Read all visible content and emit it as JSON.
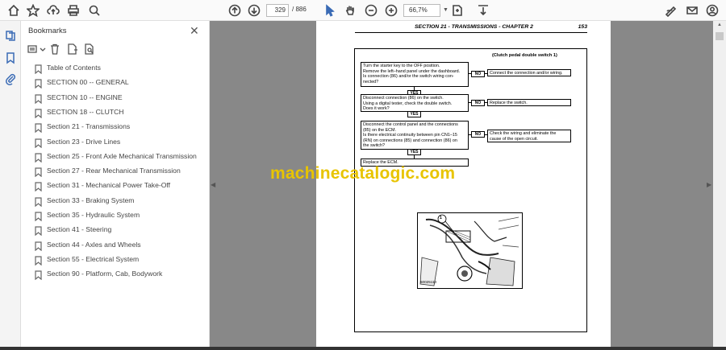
{
  "toolbar": {
    "icons": [
      "home-icon",
      "star-icon",
      "cloud-upload-icon",
      "print-icon",
      "zoom-search-icon",
      "page-up-icon",
      "page-down-icon",
      "pointer-icon",
      "hand-icon",
      "zoom-out-icon",
      "zoom-in-icon",
      "fit-page-icon",
      "scroll-mode-icon",
      "sign-icon",
      "mail-icon",
      "account-icon"
    ],
    "page_current": "329",
    "page_total": "/ 886",
    "zoom": "66,7%"
  },
  "bookmarks": {
    "title": "Bookmarks",
    "items": [
      {
        "label": "Table of Contents"
      },
      {
        "label": "SECTION 00 -- GENERAL"
      },
      {
        "label": "SECTION 10 -- ENGINE"
      },
      {
        "label": "SECTION 18 -- CLUTCH"
      },
      {
        "label": "Section 21 - Transmissions"
      },
      {
        "label": "Section 23 - Drive Lines"
      },
      {
        "label": "Section 25 - Front Axle Mechanical Transmission"
      },
      {
        "label": "Section 27 - Rear Mechanical Transmission"
      },
      {
        "label": "Section 31 - Mechanical Power Take-Off"
      },
      {
        "label": "Section 33 - Braking System"
      },
      {
        "label": "Section 35 - Hydraulic System"
      },
      {
        "label": "Section 41 - Steering"
      },
      {
        "label": "Section 44 - Axles and Wheels"
      },
      {
        "label": "Section 55 - Electrical System"
      },
      {
        "label": "Section 90 - Platform, Cab, Bodywork"
      }
    ]
  },
  "document": {
    "header": "SECTION 21 - TRANSMISSIONS - CHAPTER 2",
    "page_number": "153",
    "flowchart_title": "(Clutch pedal double switch 1)",
    "step1_line1": "Turn the starter key to the OFF position.",
    "step1_line2": "Remove the left–hand panel under the dashboard.",
    "step1_line3": "Is connection (86) and/or the switch wiring con-",
    "step1_line4": "nected?",
    "no1": "NO",
    "no1_result": "Connect the connection and/or wiring.",
    "yes1": "YES",
    "step2_line1": "Disconnect connection (86) on the switch.",
    "step2_line2": "Using a digital tester, check the double switch.",
    "step2_line3": "Does it work?",
    "no2": "NO",
    "no2_result": "Replace the switch.",
    "yes2": "YES",
    "step3_line1": "Disconnect the control panel and the connections",
    "step3_line2": "(85) on the ECM.",
    "step3_line3": "Is there electrical continuity between pin CN1–15",
    "step3_line4": "(RN) on connections (85) and connection (86) on",
    "step3_line5": "the switch?",
    "no3": "NO",
    "no3_result_line1": "Check the wiring and eliminate the",
    "no3_result_line2": "cause of the open circuit.",
    "yes3": "YES",
    "step4": "Replace the ECM.",
    "figure_callout": "1",
    "figure_caption": "50025110",
    "watermark": "machinecatalogic.com"
  }
}
